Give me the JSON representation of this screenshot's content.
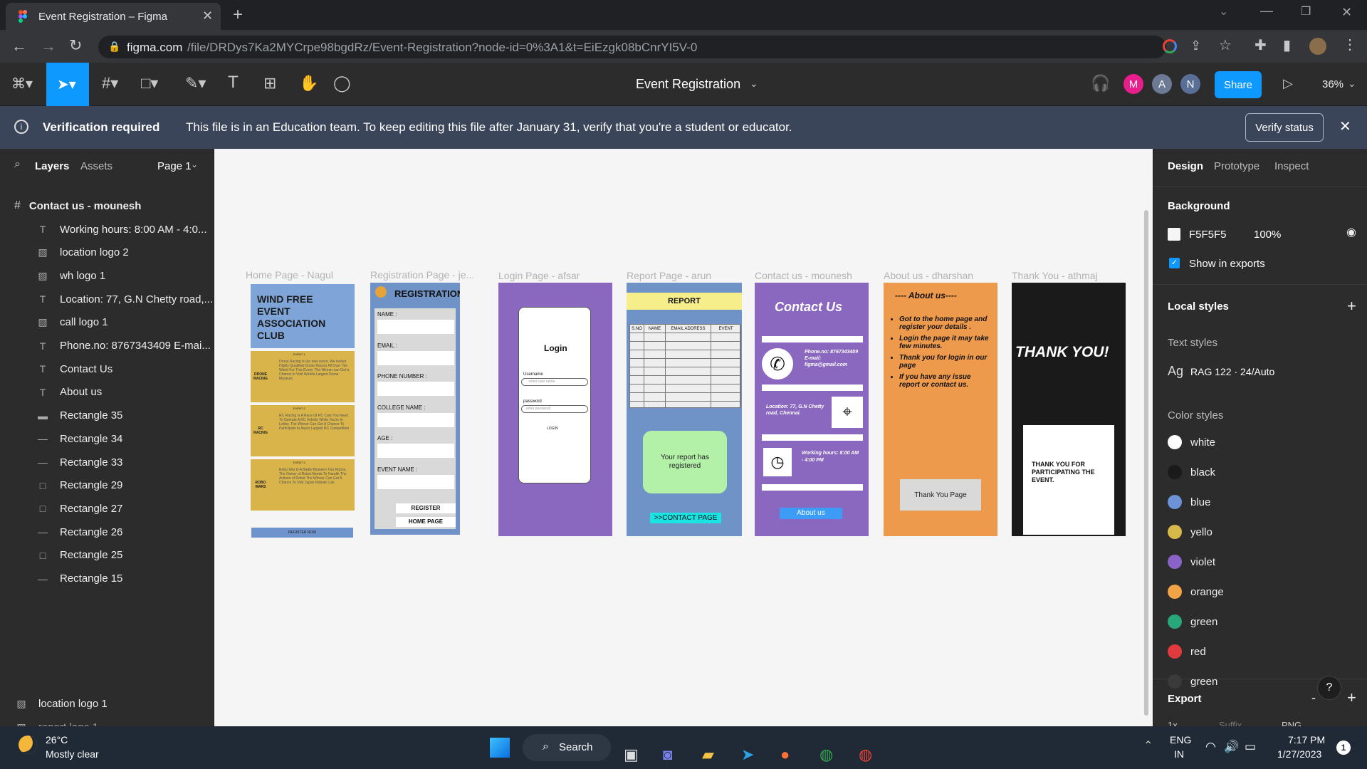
{
  "browser": {
    "tab_title": "Event Registration – Figma",
    "url_host": "figma.com",
    "url_path": "/file/DRDys7Ka2MYCrpe98bgdRz/Event-Registration?node-id=0%3A1&t=EiEzgk08bCnrYI5V-0"
  },
  "toolbar": {
    "file_name": "Event Registration",
    "share_label": "Share",
    "zoom": "36%",
    "avatars": [
      "M",
      "A",
      "N"
    ]
  },
  "banner": {
    "title": "Verification required",
    "message": "This file is in an Education team. To keep editing this file after January 31, verify that you're a student or educator.",
    "button": "Verify status"
  },
  "left_panel": {
    "tabs": [
      "Layers",
      "Assets"
    ],
    "page": "Page 1",
    "frame_name": "Contact us - mounesh",
    "layers": [
      {
        "icon": "T",
        "name": "Working hours: 8:00 AM - 4:0..."
      },
      {
        "icon": "img",
        "name": "location logo 2"
      },
      {
        "icon": "img",
        "name": "wh logo 1"
      },
      {
        "icon": "T",
        "name": "Location: 77, G.N Chetty road,..."
      },
      {
        "icon": "img",
        "name": "call logo 1"
      },
      {
        "icon": "T",
        "name": "Phone.no: 8767343409 E-mai..."
      },
      {
        "icon": "T",
        "name": "Contact Us"
      },
      {
        "icon": "T",
        "name": "About us"
      },
      {
        "icon": "rect-line",
        "name": "Rectangle 35"
      },
      {
        "icon": "line",
        "name": "Rectangle 34"
      },
      {
        "icon": "line",
        "name": "Rectangle 33"
      },
      {
        "icon": "rect",
        "name": "Rectangle 29"
      },
      {
        "icon": "rect",
        "name": "Rectangle 27"
      },
      {
        "icon": "line",
        "name": "Rectangle 26"
      },
      {
        "icon": "rect",
        "name": "Rectangle 25"
      },
      {
        "icon": "line",
        "name": "Rectangle 15"
      }
    ],
    "bottom_layers": [
      "location logo 1",
      "report logo 1"
    ]
  },
  "right_panel": {
    "tabs": [
      "Design",
      "Prototype",
      "Inspect"
    ],
    "background_label": "Background",
    "bg_hex": "F5F5F5",
    "bg_opacity": "100%",
    "show_exports": "Show in exports",
    "local_styles": "Local styles",
    "text_styles": "Text styles",
    "text_style": "RAG 122 · 24/Auto",
    "ag": "Ag",
    "color_styles": "Color styles",
    "colors": [
      {
        "name": "white",
        "hex": "#ffffff"
      },
      {
        "name": "black",
        "hex": "#1a1a1a"
      },
      {
        "name": "blue",
        "hex": "#6b93d6"
      },
      {
        "name": "yello",
        "hex": "#d6b94a"
      },
      {
        "name": "violet",
        "hex": "#8a63c9"
      },
      {
        "name": "orange",
        "hex": "#f0a347"
      },
      {
        "name": "green",
        "hex": "#27a77a"
      },
      {
        "name": "red",
        "hex": "#e0393e"
      },
      {
        "name": "green",
        "hex": "#3a3a3a"
      }
    ],
    "export_label": "Export",
    "export_row": [
      "1x",
      "Suffix",
      "PNG"
    ]
  },
  "frames": {
    "labels": [
      "Home Page - Nagul",
      "Registration Page - je...",
      "Login Page - afsar",
      "Report Page - arun",
      "Contact us - mounesh",
      "About us - dharshan",
      "Thank You - athmaj"
    ],
    "home": {
      "title": "WIND FREE EVENT ASSOCIATION CLUB",
      "events": [
        {
          "tag": "EVENT 1",
          "name": "DRONE RACING",
          "desc": "Drone Racing is our new event. We invited Highly Qualified Drone Racers All Over The World For This Event. The Winner can Get a Chance to Visit Worlds Largest Drone Museum"
        },
        {
          "tag": "EVENT 2",
          "name": "RC RACING",
          "desc": "RC Racing Is A Race Of RC Cars You Need To Operate A RC Vehicle While You're In Lobby. The Winner Can Get A Chance To Participate In Asia's Largest RC Competition"
        },
        {
          "tag": "EVENT 3",
          "name": "ROBO WARS",
          "desc": "Robo War Is A Battle Between Two Robos. The Owner of Robot Needs To Handle The Actions of Robot The Winner Can Get A Chance To Visit Japan Robotic Lab"
        }
      ],
      "register": "REGISTER NOW"
    },
    "registration": {
      "title": "REGISTRATION",
      "fields": [
        "NAME :",
        "EMAIL :",
        "PHONE NUMBER :",
        "COLLEGE NAME :",
        "AGE :",
        "EVENT NAME :"
      ],
      "register": "REGISTER",
      "home": "HOME PAGE"
    },
    "login": {
      "title": "Login",
      "username": "Username",
      "username_ph": "enter user name",
      "password": "password",
      "password_ph": "enter password",
      "button": "LOGIN"
    },
    "report": {
      "title": "REPORT",
      "cols": [
        "S.NO",
        "NAME",
        "EMAIL ADDRESS",
        "EVENT"
      ],
      "message": "Your report has registered",
      "link": ">>CONTACT PAGE"
    },
    "contact": {
      "title": "Contact Us",
      "phone": "Phone.no: 8767343409 E-mail: figma@gmail.com",
      "location": "Location: 77, G.N Chetty road, Chennai.",
      "hours": "Working hours: 8:00 AM - 4:00 PM",
      "about": "About us"
    },
    "about": {
      "title": "---- About us----",
      "items": [
        "Got to the home page and register your details .",
        "Login the page it may take few minutes.",
        "Thank you for login in our page",
        "If you have any issue report or contact us."
      ],
      "button": "Thank You Page"
    },
    "thanks": {
      "title": "THANK YOU!",
      "message": "THANK YOU FOR PARTICIPATING THE EVENT."
    }
  },
  "taskbar": {
    "temp": "26°C",
    "weather": "Mostly clear",
    "search": "Search",
    "lang1": "ENG",
    "lang2": "IN",
    "time": "7:17 PM",
    "date": "1/27/2023",
    "notif": "1"
  }
}
